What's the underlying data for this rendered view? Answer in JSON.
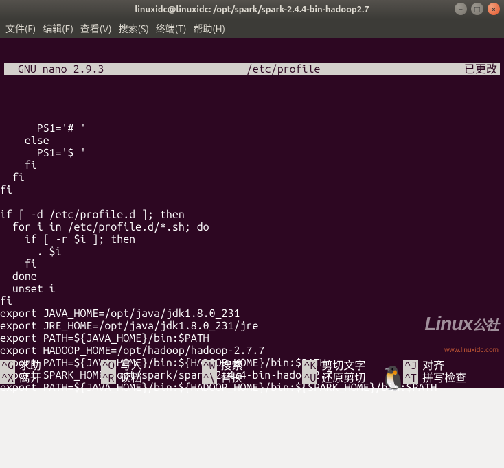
{
  "window": {
    "title": "linuxidc@linuxidc: /opt/spark/spark-2.4.4-bin-hadoop2.7"
  },
  "menu": {
    "file": "文件(F)",
    "edit": "编辑(E)",
    "view": "查看(V)",
    "search": "搜索(S)",
    "terminal": "终端(T)",
    "help": "帮助(H)"
  },
  "nano": {
    "app": "  GNU nano 2.9.3",
    "filename": "/etc/profile",
    "status": "已更改"
  },
  "lines": [
    "      PS1='# '",
    "    else",
    "      PS1='$ '",
    "    fi",
    "  fi",
    "fi",
    "",
    "if [ -d /etc/profile.d ]; then",
    "  for i in /etc/profile.d/*.sh; do",
    "    if [ -r $i ]; then",
    "      . $i",
    "    fi",
    "  done",
    "  unset i",
    "fi",
    "export JAVA_HOME=/opt/java/jdk1.8.0_231",
    "export JRE_HOME=/opt/java/jdk1.8.0_231/jre",
    "export PATH=${JAVA_HOME}/bin:$PATH",
    "export HADOOP_HOME=/opt/hadoop/hadoop-2.7.7",
    "export PATH=${JAVA_HOME}/bin:${HADOOP_HOME}/bin:$PATH",
    "export SPARK_HOME=/opt/spark/spark-2.4.4-bin-hadoop2.7",
    "export PATH=${JAVA_HOME}/bin:${HADOOP_HOME}/bin:${SPARK_HOME}/bin:$PATH"
  ],
  "shortcuts": {
    "row1": [
      {
        "key": "^G",
        "label": "求助"
      },
      {
        "key": "^O",
        "label": "写入"
      },
      {
        "key": "^W",
        "label": "搜索"
      },
      {
        "key": "^K",
        "label": "剪切文字"
      },
      {
        "key": "^J",
        "label": "对齐"
      }
    ],
    "row2": [
      {
        "key": "^X",
        "label": "离开"
      },
      {
        "key": "^R",
        "label": "读档"
      },
      {
        "key": "^\\",
        "label": "替换"
      },
      {
        "key": "^U",
        "label": "还原剪切"
      },
      {
        "key": "^T",
        "label": "拼写检查"
      }
    ]
  },
  "watermark": {
    "big": "Linux",
    "small": "www.linuxidc.com",
    "suffix": "公社"
  }
}
